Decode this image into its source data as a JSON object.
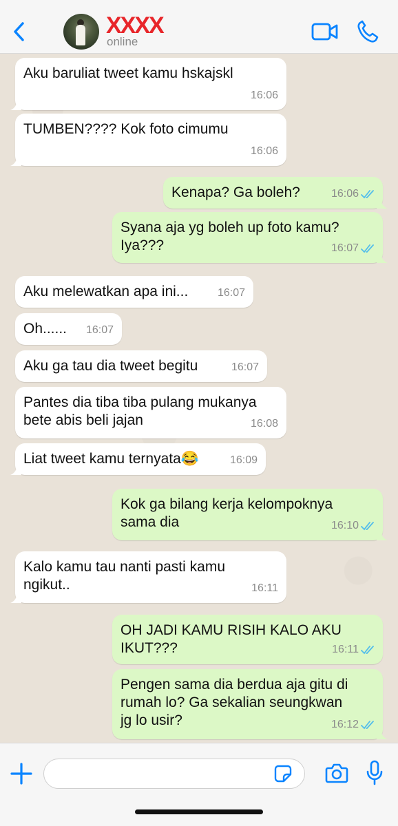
{
  "header": {
    "contact_name": "XXXX",
    "status": "online"
  },
  "colors": {
    "accent": "#0a84ff",
    "incoming_bubble": "#ffffff",
    "outgoing_bubble": "#dcf8c6",
    "read_tick": "#53bdeb",
    "name_red": "#e8262a"
  },
  "messages": [
    {
      "dir": "in",
      "text": "Aku baruliat tweet kamu hskajskl",
      "time": "16:06"
    },
    {
      "dir": "in",
      "text": "TUMBEN???? Kok foto cimumu",
      "time": "16:06"
    },
    {
      "dir": "out",
      "text": "Kenapa? Ga boleh?",
      "time": "16:06",
      "read": true
    },
    {
      "dir": "out",
      "text": "Syana aja yg boleh up foto kamu?\nIya???",
      "time": "16:07",
      "read": true
    },
    {
      "dir": "in",
      "text": "Aku melewatkan apa ini...",
      "time": "16:07"
    },
    {
      "dir": "in",
      "text": "Oh......",
      "time": "16:07"
    },
    {
      "dir": "in",
      "text": "Aku ga tau dia tweet begitu",
      "time": "16:07"
    },
    {
      "dir": "in",
      "text": "Pantes dia tiba tiba pulang mukanya\nbete abis beli jajan",
      "time": "16:08"
    },
    {
      "dir": "in",
      "text": "Liat tweet kamu ternyata😂",
      "time": "16:09"
    },
    {
      "dir": "out",
      "text": "Kok ga bilang kerja kelompoknya\nsama dia",
      "time": "16:10",
      "read": true
    },
    {
      "dir": "in",
      "text": "Kalo kamu tau nanti pasti kamu\nngikut..",
      "time": "16:11"
    },
    {
      "dir": "out",
      "text": "OH JADI KAMU RISIH KALO AKU\nIKUT???",
      "time": "16:11",
      "read": true
    },
    {
      "dir": "out",
      "text": "Pengen sama dia berdua aja gitu di\nrumah lo? Ga sekalian seungkwan\njg lo usir?",
      "time": "16:12",
      "read": true
    }
  ],
  "composer": {
    "value": "",
    "placeholder": ""
  },
  "icons": {
    "back": "chevron-left-icon",
    "video": "video-camera-icon",
    "call": "phone-icon",
    "plus": "plus-icon",
    "sticker": "sticker-icon",
    "camera": "camera-icon",
    "mic": "microphone-icon"
  }
}
